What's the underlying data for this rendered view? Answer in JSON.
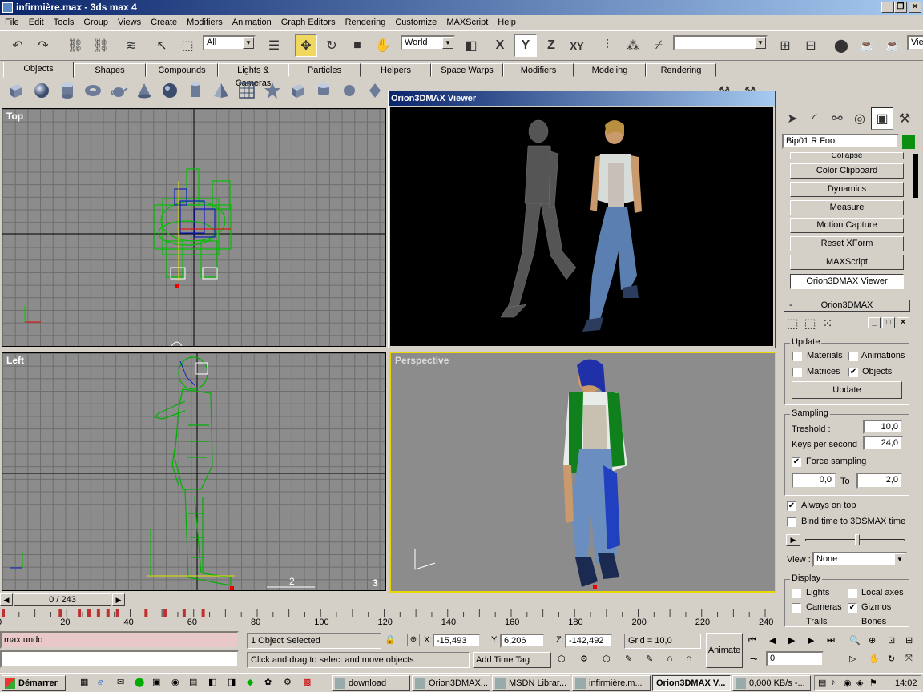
{
  "window": {
    "title": "infirmière.max - 3ds max 4"
  },
  "menu": [
    "File",
    "Edit",
    "Tools",
    "Group",
    "Views",
    "Create",
    "Modifiers",
    "Animation",
    "Graph Editors",
    "Rendering",
    "Customize",
    "MAXScript",
    "Help"
  ],
  "toolbar": {
    "selection_filter": "All",
    "coord_system": "World",
    "axis_x": "X",
    "axis_y": "Y",
    "axis_z": "Z",
    "axis_xy": "XY",
    "view_partial": "Vie"
  },
  "tabs": [
    "Objects",
    "Shapes",
    "Compounds",
    "Lights & Cameras",
    "Particles",
    "Helpers",
    "Space Warps",
    "Modifiers",
    "Modeling",
    "Rendering"
  ],
  "viewports": {
    "top": "Top",
    "left": "Left",
    "perspective": "Perspective",
    "left_grid_num1": "2",
    "left_grid_num2": "3"
  },
  "viewer": {
    "title": "Orion3DMAX Viewer"
  },
  "panel": {
    "object_name": "Bip01 R Foot",
    "rollout_buttons": [
      "Collapse",
      "Color Clipboard",
      "Dynamics",
      "Measure",
      "Motion Capture",
      "Reset XForm",
      "MAXScript",
      "Orion3DMAX Viewer"
    ],
    "rollout_title": "Orion3DMAX",
    "rollout_minus": "-",
    "update": {
      "title": "Update",
      "materials": "Materials",
      "animations": "Animations",
      "matrices": "Matrices",
      "objects": "Objects",
      "button": "Update"
    },
    "sampling": {
      "title": "Sampling",
      "treshold_label": "Treshold :",
      "treshold": "10,0",
      "keys_label": "Keys per second :",
      "keys": "24,0",
      "force": "Force sampling",
      "from": "0,0",
      "to_label": "To",
      "to": "2,0"
    },
    "always_on_top": "Always on top",
    "bind_time": "Bind time to 3DSMAX time",
    "view_label": "View :",
    "view_value": "None",
    "display": {
      "title": "Display",
      "lights": "Lights",
      "local_axes": "Local axes",
      "cameras": "Cameras",
      "gizmos": "Gizmos",
      "trails": "Trails",
      "bones": "Bones"
    }
  },
  "timeline": {
    "frame": "0 / 243"
  },
  "ruler": {
    "ticks": [
      "0",
      "20",
      "40",
      "60",
      "80",
      "100",
      "120",
      "140",
      "160",
      "180",
      "200",
      "220",
      "240"
    ]
  },
  "status": {
    "maxscript_line1": "max undo",
    "selected": "1 Object Selected",
    "x_label": "X:",
    "x": "-15,493",
    "y_label": "Y:",
    "y": "6,206",
    "z_label": "Z:",
    "z": "-142,492",
    "grid": "Grid = 10,0",
    "prompt": "Click and drag to select and move objects",
    "add_time_tag": "Add Time Tag",
    "animate": "Animate",
    "frame_field": "0"
  },
  "taskbar": {
    "start": "Démarrer",
    "tasks": [
      "download",
      "Orion3DMAX...",
      "MSDN Librar...",
      "infirmière.m...",
      "Orion3DMAX V...",
      "0,000 KB/s -..."
    ],
    "clock": "14:02"
  },
  "colors": {
    "titlebar": "#0a246a",
    "active_vp": "#e8d800",
    "wire": "#00a000"
  }
}
